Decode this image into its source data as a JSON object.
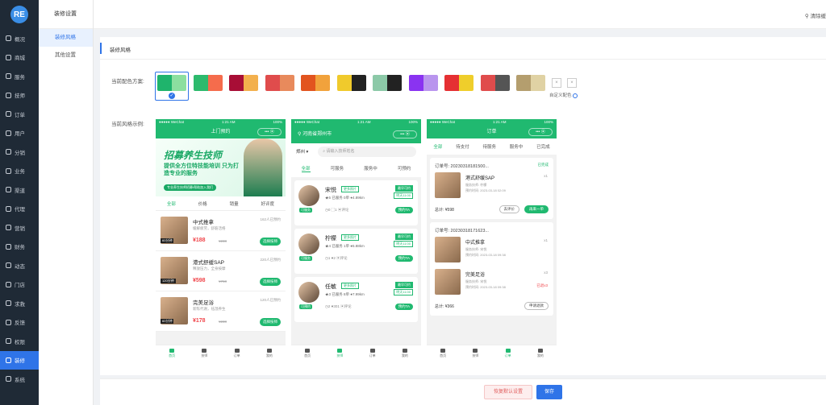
{
  "nav": {
    "logo": "RE",
    "items": [
      {
        "label": "概况",
        "active": false
      },
      {
        "label": "商城",
        "active": false
      },
      {
        "label": "服务",
        "active": false
      },
      {
        "label": "技师",
        "active": false
      },
      {
        "label": "订单",
        "active": false
      },
      {
        "label": "用户",
        "active": false
      },
      {
        "label": "分销",
        "active": false
      },
      {
        "label": "业务",
        "active": false
      },
      {
        "label": "渠道",
        "active": false
      },
      {
        "label": "代理",
        "active": false
      },
      {
        "label": "营销",
        "active": false
      },
      {
        "label": "财务",
        "active": false
      },
      {
        "label": "动态",
        "active": false
      },
      {
        "label": "门店",
        "active": false
      },
      {
        "label": "求救",
        "active": false
      },
      {
        "label": "反馈",
        "active": false
      },
      {
        "label": "权限",
        "active": false
      },
      {
        "label": "装修",
        "active": true
      },
      {
        "label": "系统",
        "active": false
      }
    ]
  },
  "subnav": {
    "title": "装修设置",
    "items": [
      {
        "label": "装修风格",
        "active": true
      },
      {
        "label": "其他设置",
        "active": false
      }
    ]
  },
  "topbar": {
    "clear_cache": "清除缓"
  },
  "panel": {
    "title": "装修风格",
    "scheme_label": "当前配色方案:",
    "preview_label": "当前风格示例:",
    "custom_label": "自定义配色",
    "swatches": [
      [
        "#1fb46c",
        "#8cdf9f"
      ],
      [
        "#2dba6d",
        "#f56c4c"
      ],
      [
        "#a80e36",
        "#f3b04d"
      ],
      [
        "#e04c4c",
        "#e88a5c"
      ],
      [
        "#e2541f",
        "#f1a23c"
      ],
      [
        "#f0ca2c",
        "#222222"
      ],
      [
        "#8cc9a8",
        "#222222"
      ],
      [
        "#8a33f1",
        "#b995ee"
      ],
      [
        "#e53033",
        "#efce2b"
      ],
      [
        "#e04c4c",
        "#555555"
      ],
      [
        "#b49e6e",
        "#e0d2a4"
      ]
    ],
    "mini_buttons": [
      "×",
      "×"
    ]
  },
  "phone1": {
    "status_left": "●●●●● WeChat",
    "status_mid": "1:21 AM",
    "status_right": "100%",
    "title": "上门预约",
    "capsule": "•••  ⦿",
    "banner_title": "招募养生技师",
    "banner_sub": "提供全方位特技能培训 只为打造专业的服务",
    "banner_btn": "专业养生技师招募/帮助加入我们",
    "filters": [
      "全部",
      "价格",
      "销量",
      "好评度"
    ],
    "services": [
      {
        "name": "中式推拿",
        "desc": "缓解疲劳，舒筋活络",
        "duration": "60分钟",
        "price": "¥188",
        "old": "¥238",
        "booked": "162人已预约",
        "btn": "选择技师"
      },
      {
        "name": "港式舒缓SAP",
        "desc": "释放压力，全身按摩",
        "duration": "120分钟",
        "price": "¥598",
        "old": "¥768",
        "booked": "220人已预约",
        "btn": "选择技师"
      },
      {
        "name": "完美足浴",
        "desc": "新陈代谢，祛湿养生",
        "duration": "60分钟",
        "price": "¥178",
        "old": "¥238",
        "booked": "120人已预约",
        "btn": "选择技师"
      }
    ],
    "tabs": [
      "首页",
      "技师",
      "订单",
      "我的"
    ]
  },
  "phone2": {
    "status_left": "●●●●● WeChat",
    "status_mid": "1:21 AM",
    "status_right": "100%",
    "location": "河南省郑州市",
    "capsule": "•••  ⦿",
    "city": "郑州 ▾",
    "search_placeholder": "请输入技师姓名",
    "tabs": [
      "全部",
      "可服务",
      "服务中",
      "可预约"
    ],
    "techs": [
      {
        "name": "宋悦",
        "more": "更多照片",
        "tag": "可服务",
        "meta": "★5  已服务 0单  ●4.89km",
        "meta2": "◷0  ▢1  ▣评论",
        "avail": "最早可约",
        "soon": "明天11:00",
        "book": "预约TA"
      },
      {
        "name": "柠檬",
        "more": "更多照片",
        "tag": "可服务",
        "meta": "★4  已服务 1单  ●5.88km",
        "meta2": "◷1  ♥2  ▣评论",
        "avail": "最早可约",
        "soon": "明天11:00",
        "book": "预约TA"
      },
      {
        "name": "任敏",
        "more": "更多照片",
        "tag": "可预约",
        "meta": "★3  已服务 8单  ●7.99km",
        "meta2": "◷2  ♥301  ▣评论",
        "avail": "最早可约",
        "soon": "明天11:00",
        "book": "预约TA"
      }
    ],
    "tabbar": [
      "首页",
      "技师",
      "订单",
      "我的"
    ]
  },
  "phone3": {
    "status_left": "●●●●● WeChat",
    "status_mid": "1:21 AM",
    "status_right": "100%",
    "title": "订单",
    "capsule": "•••  ⦿",
    "tabs": [
      "全部",
      "待支付",
      "待服务",
      "服务中",
      "已完成"
    ],
    "orders": [
      {
        "no": "订单号: 20230318181500...",
        "status": "已完成",
        "items": [
          {
            "name": "港式舒缓SAP",
            "qty": "x1",
            "tech": "服务技师: 柠檬",
            "time": "预约时间: 2023-03-18 02:09",
            "refund": ""
          }
        ],
        "total": "总计: ¥598",
        "buttons": [
          "去评价",
          "再来一单"
        ]
      },
      {
        "no": "订单号: 20230318171623...",
        "status": "",
        "items": [
          {
            "name": "中式推拿",
            "qty": "x1",
            "tech": "服务技师: 宋悦",
            "time": "预约时间: 2023-03-18 09:38",
            "refund": ""
          },
          {
            "name": "完美足浴",
            "qty": "x3",
            "tech": "服务技师: 宋悦",
            "time": "预约时间: 2023-03-18 09:38",
            "refund": "已退x3"
          }
        ],
        "total": "总计: ¥366",
        "buttons": [
          "申请退款"
        ]
      }
    ],
    "tabbar": [
      "首页",
      "技师",
      "订单",
      "我的"
    ]
  },
  "footer": {
    "restore": "恢复默认设置",
    "save": "保存"
  }
}
